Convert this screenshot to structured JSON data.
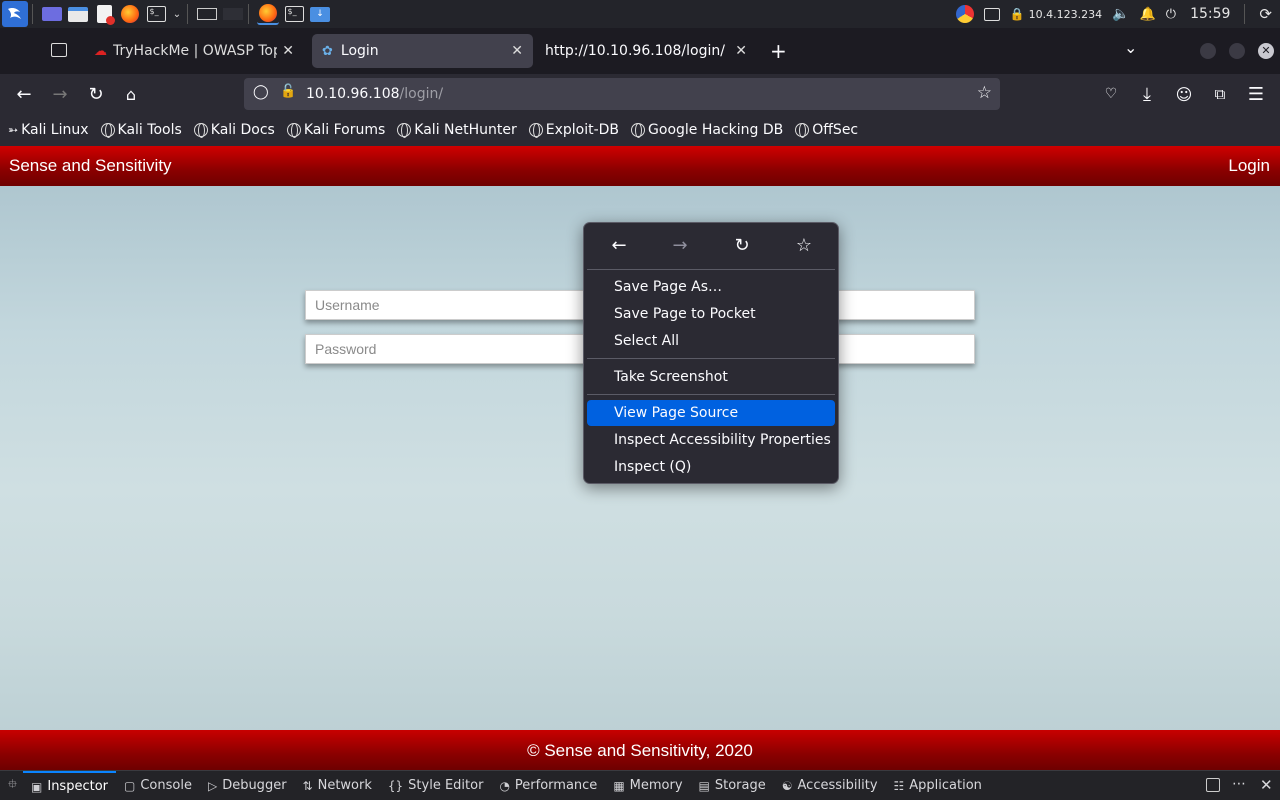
{
  "taskbar": {
    "ip": "10.4.123.234",
    "time": "15:59"
  },
  "tabs": [
    {
      "label": "TryHackMe | OWASP Top",
      "active": false
    },
    {
      "label": "Login",
      "active": true
    },
    {
      "label": "http://10.10.96.108/login/",
      "active": false
    }
  ],
  "url": {
    "host": "10.10.96.108",
    "path": "/login/"
  },
  "bookmarks": [
    "Kali Linux",
    "Kali Tools",
    "Kali Docs",
    "Kali Forums",
    "Kali NetHunter",
    "Exploit-DB",
    "Google Hacking DB",
    "OffSec"
  ],
  "site": {
    "brand": "Sense and Sensitivity",
    "login_link": "Login",
    "username_placeholder": "Username",
    "password_placeholder": "Password",
    "footer": "© Sense and Sensitivity, 2020"
  },
  "context_menu": {
    "items": [
      "Save Page As…",
      "Save Page to Pocket",
      "Select All",
      "Take Screenshot",
      "View Page Source",
      "Inspect Accessibility Properties",
      "Inspect (Q)"
    ],
    "highlighted": "View Page Source"
  },
  "devtools": {
    "tabs": [
      "Inspector",
      "Console",
      "Debugger",
      "Network",
      "Style Editor",
      "Performance",
      "Memory",
      "Storage",
      "Accessibility",
      "Application"
    ],
    "active": "Inspector"
  },
  "colors": {
    "accent": "#0061e0",
    "header_red": "#a00000"
  }
}
